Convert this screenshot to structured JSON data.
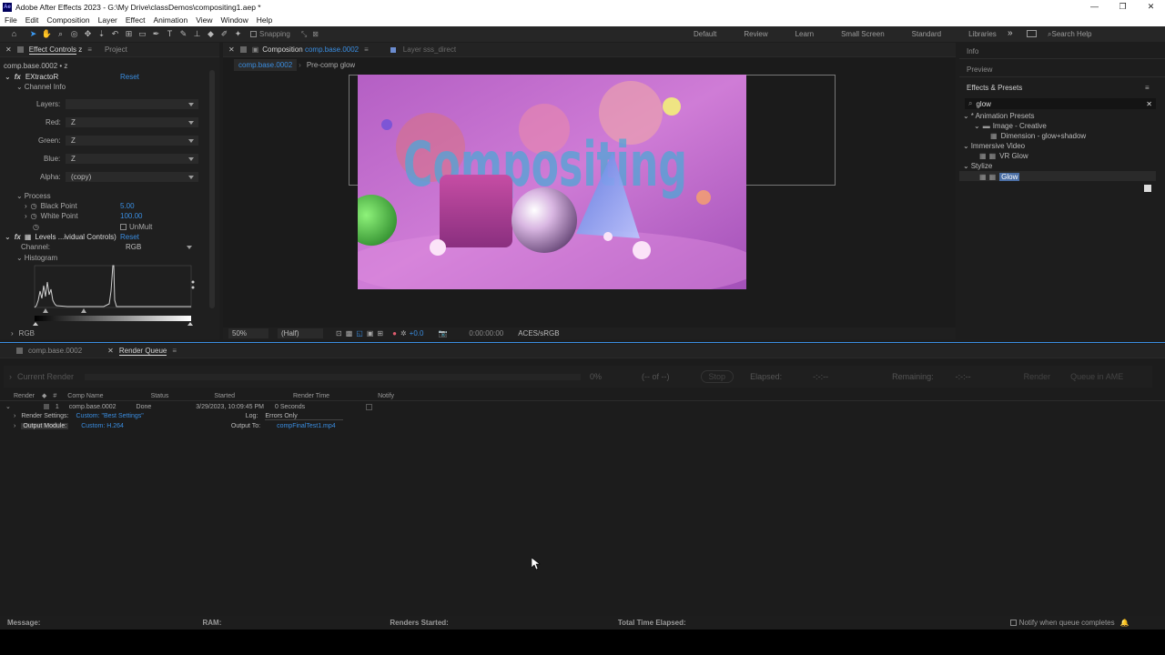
{
  "title_bar": {
    "title": "Adobe After Effects 2023 - G:\\My Drive\\classDemos\\compositing1.aep *",
    "minimize": "—",
    "restore": "❐",
    "close": "✕"
  },
  "menu": [
    "File",
    "Edit",
    "Composition",
    "Layer",
    "Effect",
    "Animation",
    "View",
    "Window",
    "Help"
  ],
  "toolbar": {
    "snapping_label": "Snapping",
    "workspaces": [
      "Default",
      "Review",
      "Learn",
      "Small Screen",
      "Standard",
      "Libraries"
    ],
    "overflow": "»",
    "search_help": "Search Help"
  },
  "effect_controls": {
    "tab_label": "Effect Controls",
    "tab_suffix": "z",
    "project_tab": "Project",
    "layer_path": "comp.base.0002 • z",
    "fx1_name": "EXtractoR",
    "fx1_reset": "Reset",
    "channel_info": "Channel Info",
    "layers_label": "Layers:",
    "red_label": "Red:",
    "red_value": "Z",
    "green_label": "Green:",
    "green_value": "Z",
    "blue_label": "Blue:",
    "blue_value": "Z",
    "alpha_label": "Alpha:",
    "alpha_value": "(copy)",
    "process_label": "Process",
    "black_point_label": "Black Point",
    "black_point_value": "5.00",
    "white_point_label": "White Point",
    "white_point_value": "100.00",
    "unmult_label": "UnMult",
    "fx2_name": "Levels ...ividual Controls)",
    "fx2_reset": "Reset",
    "channel_label": "Channel:",
    "channel_value": "RGB",
    "histogram_label": "Histogram",
    "rgb_label": "RGB"
  },
  "composition": {
    "tab_prefix": "Composition",
    "tab_name": "comp.base.0002",
    "layer_tab": "Layer  sss_direct",
    "breadcrumb_active": "comp.base.0002",
    "breadcrumb_next": "Pre-comp glow",
    "viewer_text": "Compositing",
    "zoom": "50%",
    "resolution": "(Half)",
    "exposure": "+0.0",
    "timecode": "0:00:00:00",
    "color_space": "ACES/sRGB"
  },
  "right_panels": {
    "info": "Info",
    "preview": "Preview",
    "effects_presets": "Effects & Presets",
    "search_value": "glow",
    "tree": [
      {
        "label": "* Animation Presets",
        "indent": 0
      },
      {
        "label": "Image - Creative",
        "indent": 1
      },
      {
        "label": "Dimension - glow+shadow",
        "indent": 2
      },
      {
        "label": "Immersive Video",
        "indent": 0
      },
      {
        "label": "VR Glow",
        "indent": 1
      },
      {
        "label": "Stylize",
        "indent": 0
      },
      {
        "label": "Glow",
        "indent": 1
      }
    ]
  },
  "render_queue": {
    "timeline_tab": "comp.base.0002",
    "rq_tab": "Render Queue",
    "current_render": "Current Render",
    "percent": "0%",
    "eta": "(-- of --)",
    "stop": "Stop",
    "elapsed_label": "Elapsed:",
    "elapsed_value": "-:-:--",
    "remaining_label": "Remaining:",
    "remaining_value": "-:-:--",
    "media_btn": "Render",
    "queue_ame": "Queue in AME",
    "headers": {
      "render": "Render",
      "num": "#",
      "comp": "Comp Name",
      "status": "Status",
      "started": "Started",
      "render_time": "Render Time",
      "notify": "Notify"
    },
    "item": {
      "num": "1",
      "comp": "comp.base.0002",
      "status": "Done",
      "started": "3/29/2023, 10:09:45 PM",
      "render_time": "0 Seconds"
    },
    "render_settings_label": "Render Settings:",
    "render_settings_value": "Custom: \"Best Settings\"",
    "log_label": "Log:",
    "log_value": "Errors Only",
    "output_module_label": "Output Module:",
    "output_module_value": "Custom: H.264",
    "output_to_label": "Output To:",
    "output_to_value": "compFinalTest1.mp4"
  },
  "status_bar": {
    "message": "Message:",
    "ram": "RAM:",
    "renders_started": "Renders Started:",
    "total_time": "Total Time Elapsed:",
    "notify": "Notify when queue completes"
  },
  "colors": {
    "accent": "#3a8de0",
    "panel": "#1f1f1f",
    "selection": "#4b6fa5"
  }
}
